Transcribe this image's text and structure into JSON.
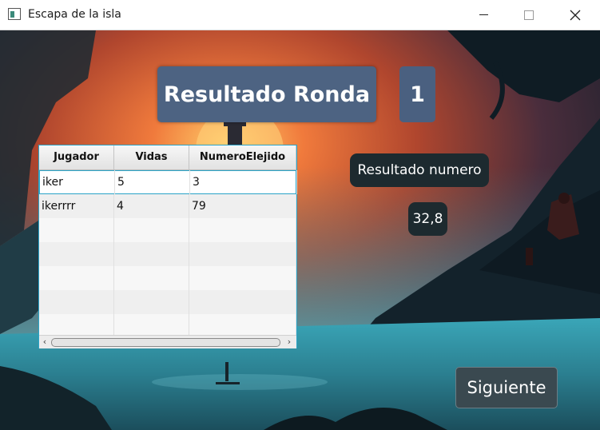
{
  "window": {
    "title": "Escapa de la isla",
    "icons": {
      "app": "app-window-icon",
      "minimize": "minimize-icon",
      "maximize": "maximize-icon",
      "close": "close-icon"
    }
  },
  "header": {
    "title": "Resultado Ronda",
    "round": "1"
  },
  "table": {
    "columns": [
      "Jugador",
      "Vidas",
      "NumeroElejido"
    ],
    "rows": [
      [
        "iker",
        "5",
        "3"
      ],
      [
        "ikerrrr",
        "4",
        "79"
      ]
    ]
  },
  "result": {
    "label": "Resultado numero",
    "value": "32,8"
  },
  "buttons": {
    "next": "Siguiente"
  },
  "colors": {
    "panel": "#4d6382",
    "dark_panel": "#1d2a2f",
    "accent": "#2aa4c8"
  }
}
